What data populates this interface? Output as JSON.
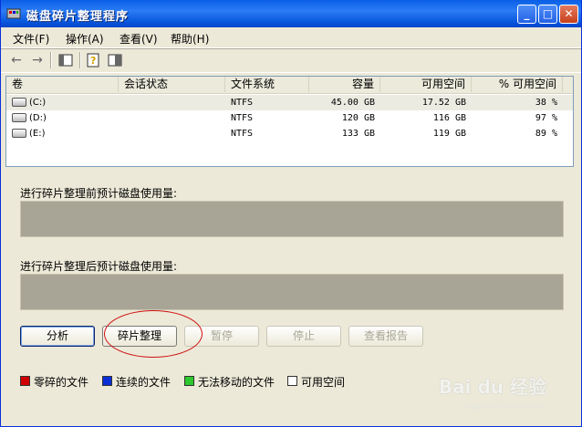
{
  "window": {
    "title": "磁盘碎片整理程序",
    "minimize": "_",
    "maximize": "□",
    "close": "✕"
  },
  "menu": [
    "文件(F)",
    "操作(A)",
    "查看(V)",
    "帮助(H)"
  ],
  "columns": [
    "卷",
    "会话状态",
    "文件系统",
    "容量",
    "可用空间",
    "% 可用空间"
  ],
  "volumes": [
    {
      "name": "(C:)",
      "status": "",
      "fs": "NTFS",
      "capacity": "45.00 GB",
      "free": "17.52 GB",
      "pct": "38 %"
    },
    {
      "name": "(D:)",
      "status": "",
      "fs": "NTFS",
      "capacity": "120 GB",
      "free": "116 GB",
      "pct": "97 %"
    },
    {
      "name": "(E:)",
      "status": "",
      "fs": "NTFS",
      "capacity": "133 GB",
      "free": "119 GB",
      "pct": "89 %"
    }
  ],
  "labels": {
    "before": "进行碎片整理前预计磁盘使用量:",
    "after": "进行碎片整理后预计磁盘使用量:"
  },
  "buttons": {
    "analyze": "分析",
    "defrag": "碎片整理",
    "pause": "暂停",
    "stop": "停止",
    "report": "查看报告"
  },
  "legend": [
    {
      "label": "零碎的文件",
      "color": "#d00000"
    },
    {
      "label": "连续的文件",
      "color": "#0a2fd6"
    },
    {
      "label": "无法移动的文件",
      "color": "#2ec82e"
    },
    {
      "label": "可用空间",
      "color": "#ffffff"
    }
  ],
  "watermark": {
    "main": "Bai du 经验",
    "sub": "jingyan.baidu.com"
  },
  "colors": {
    "title_bar": "#0a5fe6",
    "usage_box": "#a8a596",
    "highlight": "#d01010"
  }
}
